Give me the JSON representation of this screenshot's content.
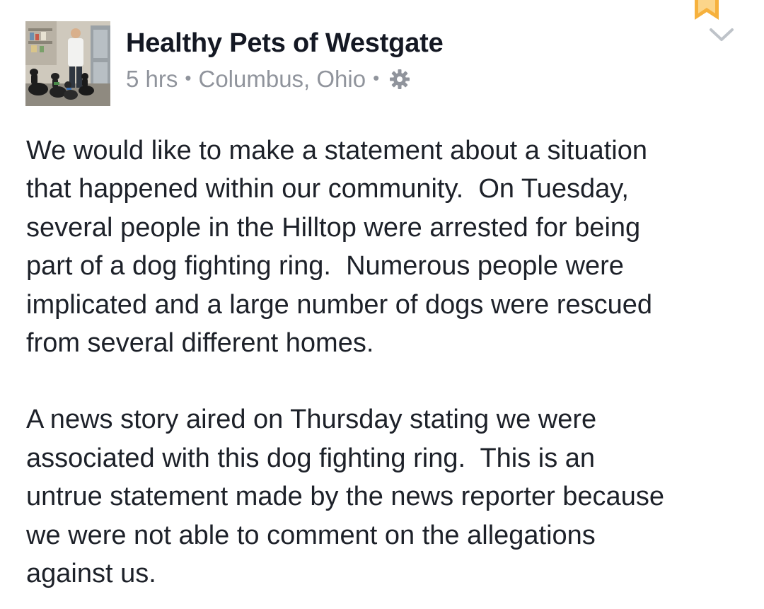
{
  "post": {
    "author": "Healthy Pets of Westgate",
    "time": "5 hrs",
    "separator": "•",
    "location": "Columbus, Ohio",
    "privacy_icon": "gear-icon",
    "bookmark_icon": "bookmark-ribbon-icon",
    "menu_icon": "chevron-down-icon",
    "avatar_alt": "profile-photo",
    "paragraphs": [
      "We would like to make a statement about a situation\nthat happened within our community.  On Tuesday,\nseveral people in the Hilltop were arrested for being\npart of a dog fighting ring.  Numerous people were\nimplicated and a large number of dogs were rescued\nfrom several different homes.",
      "A news story aired on Thursday stating we were\nassociated with this dog fighting ring.  This is an\nuntrue statement made by the news reporter because\nwe were not able to comment on the allegations\nagainst us."
    ]
  },
  "colors": {
    "text": "#1d2129",
    "name": "#141823",
    "meta": "#90949c",
    "bookmark": "#f6b13d",
    "chevron": "#bec3c9"
  }
}
